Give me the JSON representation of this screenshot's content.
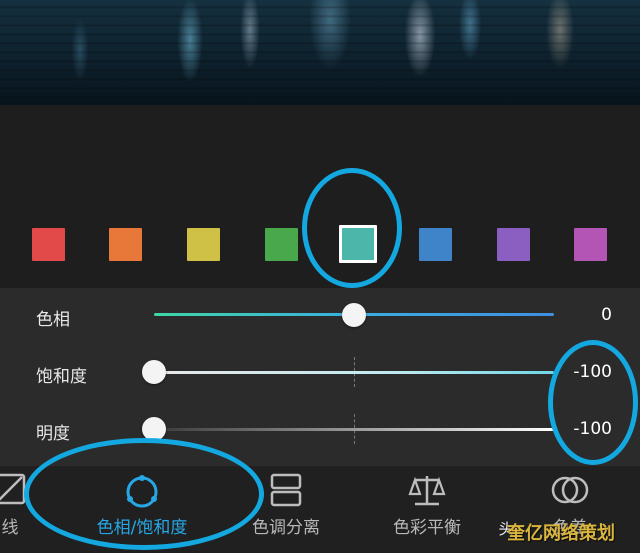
{
  "swatches": [
    {
      "name": "red",
      "color": "#e24a4a"
    },
    {
      "name": "orange",
      "color": "#e8783a"
    },
    {
      "name": "yellow",
      "color": "#cfc046"
    },
    {
      "name": "green",
      "color": "#4aa84c"
    },
    {
      "name": "aqua",
      "color": "#4db6ab",
      "selected": true
    },
    {
      "name": "blue",
      "color": "#3f83c8"
    },
    {
      "name": "purple",
      "color": "#8b5fc2"
    },
    {
      "name": "magenta",
      "color": "#b255b4"
    }
  ],
  "sliders": [
    {
      "label": "色相",
      "value": "0",
      "level": 0.5
    },
    {
      "label": "饱和度",
      "value": "-100",
      "level": 0.0
    },
    {
      "label": "明度",
      "value": "-100",
      "level": 0.0
    }
  ],
  "tabs": [
    {
      "label": "线",
      "icon": "tone-curve-icon"
    },
    {
      "label": "色相/饱和度",
      "icon": "hue-saturation-icon",
      "active": true
    },
    {
      "label": "色调分离",
      "icon": "split-tone-icon"
    },
    {
      "label": "色彩平衡",
      "icon": "balance-scale-icon"
    },
    {
      "label": "头",
      "icon": "face-icon"
    },
    {
      "label": "色差",
      "icon": "chromatic-aberration-icon"
    }
  ],
  "watermark": "奎亿网络策划",
  "accent_color": "#14a8e0"
}
